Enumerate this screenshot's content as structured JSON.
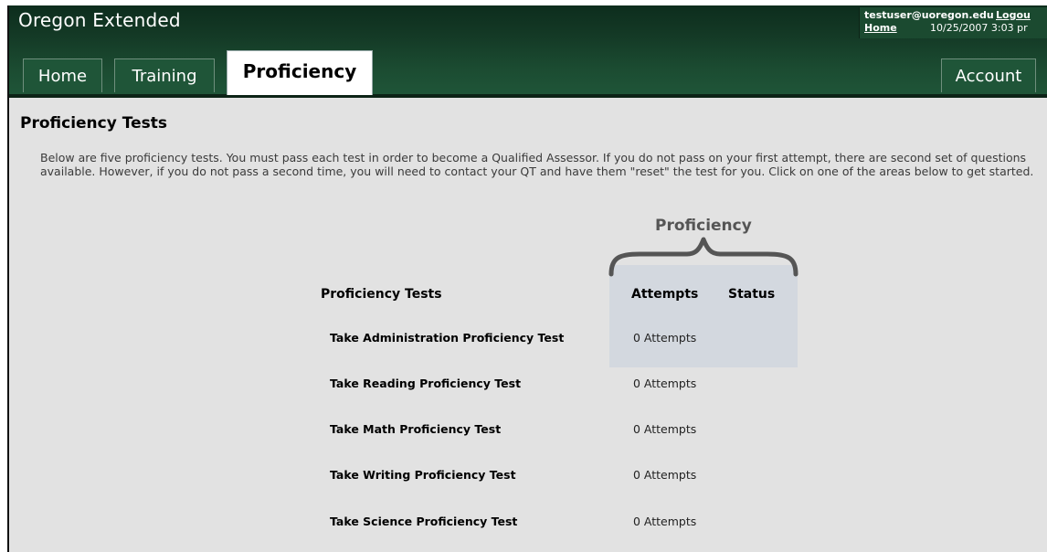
{
  "header": {
    "app_title": "Oregon Extended",
    "user_email": "testuser@uoregon.edu",
    "logout_label": "Logou",
    "home_label": "Home",
    "datetime": "10/25/2007  3:03 pr"
  },
  "tabs": {
    "home": "Home",
    "training": "Training",
    "proficiency": "Proficiency",
    "account": "Account"
  },
  "page": {
    "title": "Proficiency Tests",
    "intro": "Below are five proficiency tests. You must pass each test in order to become a Qualified Assessor. If you do not pass on your first attempt, there are second set of questions available. However, if you do not pass a second time, you will need to contact your QT and have them \"reset\" the test for you. Click on one of the areas below to get started."
  },
  "table": {
    "group_heading": "Proficiency",
    "columns": {
      "tests": "Proficiency Tests",
      "attempts": "Attempts",
      "status": "Status"
    },
    "rows": [
      {
        "test": "Take Administration Proficiency Test",
        "attempts": "0 Attempts",
        "status": ""
      },
      {
        "test": "Take Reading Proficiency Test",
        "attempts": "0 Attempts",
        "status": ""
      },
      {
        "test": "Take Math Proficiency Test",
        "attempts": "0 Attempts",
        "status": ""
      },
      {
        "test": "Take Writing Proficiency Test",
        "attempts": "0 Attempts",
        "status": ""
      },
      {
        "test": "Take Science Proficiency Test",
        "attempts": "0 Attempts",
        "status": ""
      }
    ]
  },
  "colors": {
    "header_green": "#1f5538",
    "page_bg": "#e2e2e2",
    "proficiency_highlight": "#d3d8df",
    "brace": "#555555"
  }
}
